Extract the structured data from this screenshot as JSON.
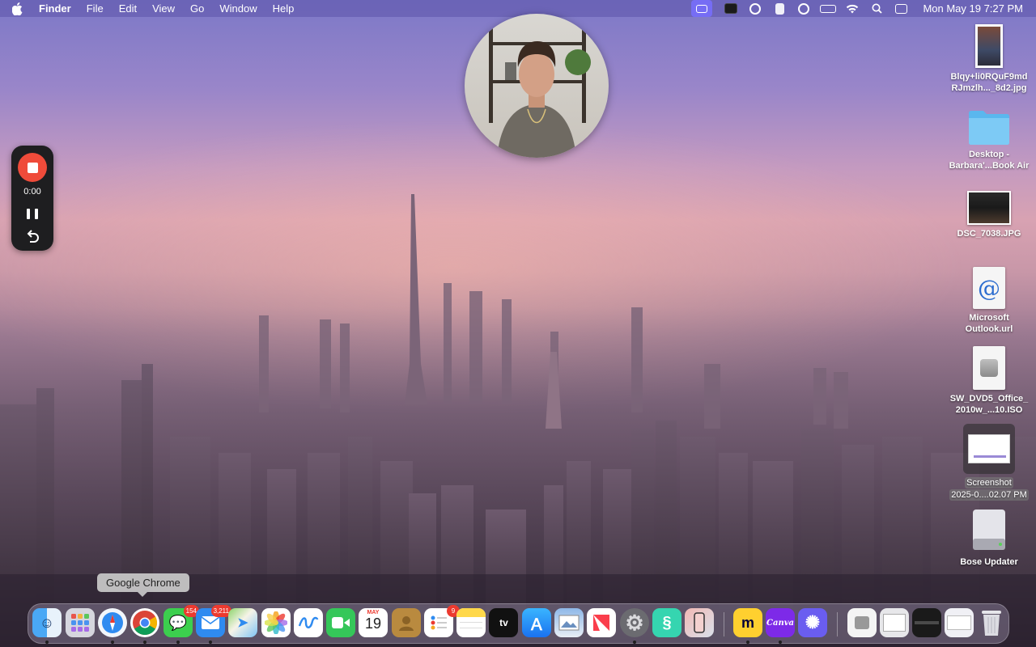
{
  "menubar": {
    "app_name": "Finder",
    "menus": [
      "File",
      "Edit",
      "View",
      "Go",
      "Window",
      "Help"
    ],
    "status_icons": [
      "screen-share-icon",
      "stage-manager-icon",
      "extension-icon",
      "contacts-icon",
      "media-play-icon",
      "battery-icon",
      "wifi-icon",
      "search-icon",
      "control-center-icon"
    ],
    "clock": "Mon May 19  7:27 PM"
  },
  "recorder": {
    "time": "0:00"
  },
  "desktop_items": [
    {
      "label_line1": "Blqy+li0RQuF9md",
      "label_line2": "RJmzlh..._8d2.jpg"
    },
    {
      "label_line1": "Desktop -",
      "label_line2": "Barbara'...Book Air"
    },
    {
      "label_line1": "DSC_7038.JPG",
      "label_line2": ""
    },
    {
      "label_line1": "Microsoft",
      "label_line2": "Outlook.url"
    },
    {
      "label_line1": "SW_DVD5_Office_",
      "label_line2": "2010w_...10.ISO"
    },
    {
      "label_line1": "Screenshot",
      "label_line2": "2025-0....02.07 PM"
    },
    {
      "label_line1": "Bose Updater",
      "label_line2": ""
    }
  ],
  "tooltip": "Google Chrome",
  "dock": {
    "messages_badge": "154",
    "mail_badge": "3,211",
    "reminders_badge": "9",
    "calendar_month": "MAY",
    "calendar_day": "19",
    "appletv_label": "tv",
    "canva_label": "Canva",
    "colors": {
      "finder": "#3a8ff0",
      "messages": "#3ccf4e",
      "facetime": "#35c759",
      "mail": "#2f8bf0",
      "miro": "#ffd02f",
      "canva": "#7d2ae8",
      "notes": "#ffd84a"
    }
  }
}
